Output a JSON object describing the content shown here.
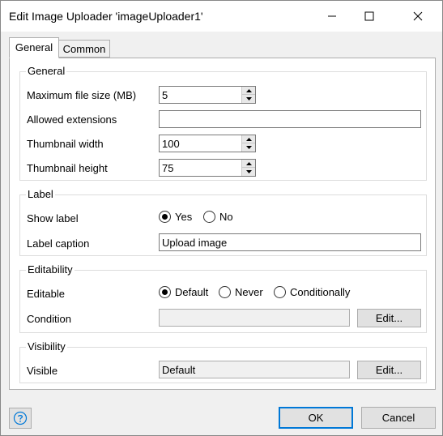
{
  "window": {
    "title": "Edit Image Uploader 'imageUploader1'",
    "icons": {
      "minimize": "minimize-icon",
      "maximize": "maximize-icon",
      "close": "close-icon"
    }
  },
  "tabs": [
    {
      "label": "General",
      "active": true
    },
    {
      "label": "Common",
      "active": false
    }
  ],
  "general": {
    "legend": "General",
    "max_file_size": {
      "label": "Maximum file size (MB)",
      "value": "5"
    },
    "allowed_extensions": {
      "label": "Allowed extensions",
      "value": ""
    },
    "thumbnail_width": {
      "label": "Thumbnail width",
      "value": "100"
    },
    "thumbnail_height": {
      "label": "Thumbnail height",
      "value": "75"
    }
  },
  "label_group": {
    "legend": "Label",
    "show_label": {
      "label": "Show label",
      "options": [
        "Yes",
        "No"
      ],
      "selected": "Yes"
    },
    "label_caption": {
      "label": "Label caption",
      "value": "Upload image"
    }
  },
  "editability": {
    "legend": "Editability",
    "editable": {
      "label": "Editable",
      "options": [
        "Default",
        "Never",
        "Conditionally"
      ],
      "selected": "Default"
    },
    "condition": {
      "label": "Condition",
      "value": "",
      "button": "Edit..."
    }
  },
  "visibility": {
    "legend": "Visibility",
    "visible": {
      "label": "Visible",
      "value": "Default",
      "button": "Edit..."
    }
  },
  "footer": {
    "help_icon": "help-icon",
    "ok": "OK",
    "cancel": "Cancel"
  },
  "colors": {
    "ok_border": "#0078d7",
    "help_icon": "#0078d7"
  }
}
